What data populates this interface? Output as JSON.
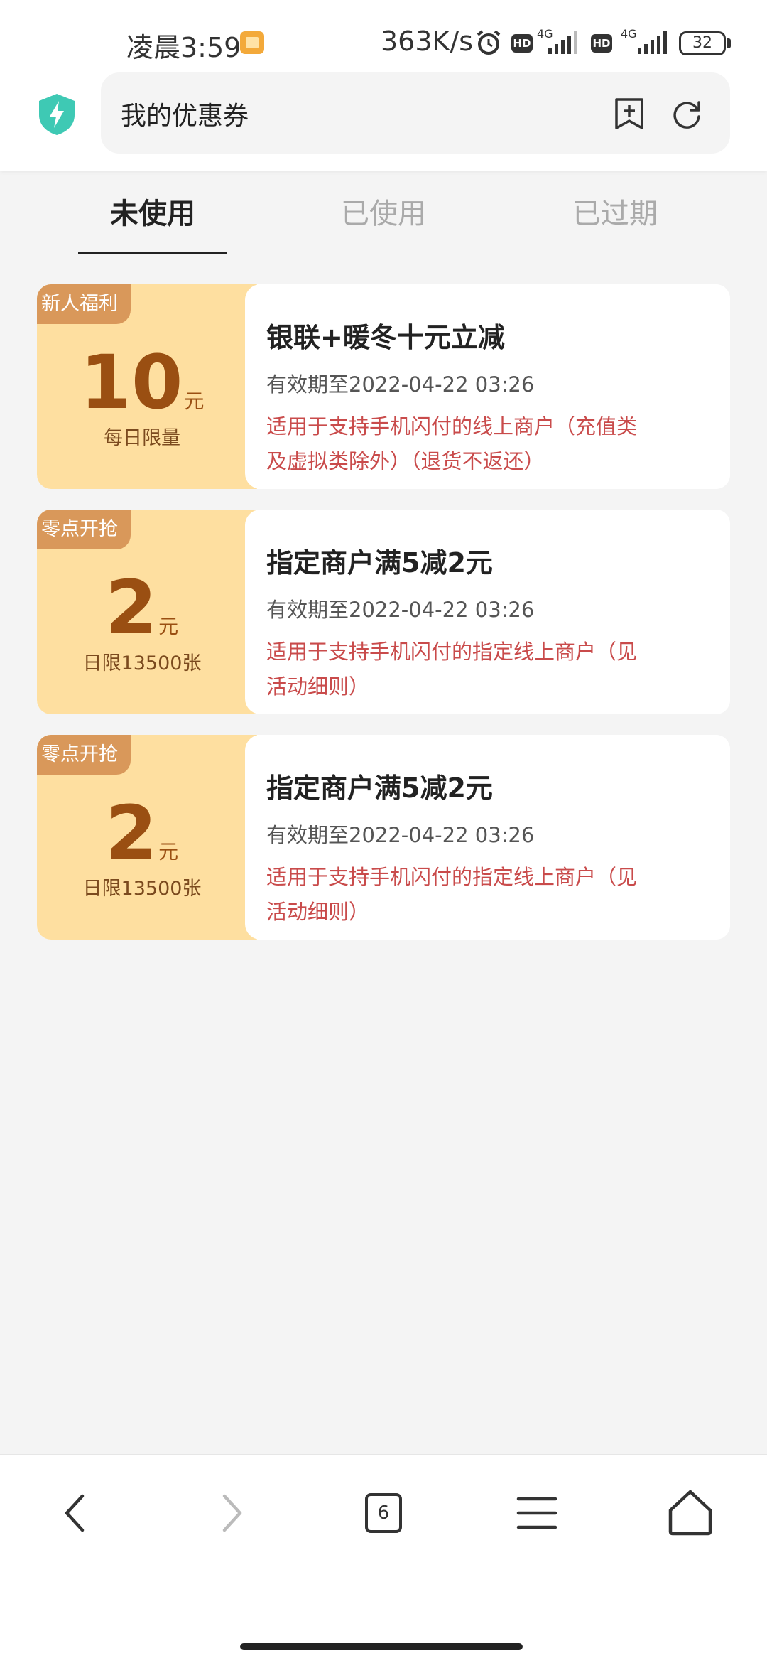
{
  "status_bar": {
    "time": "凌晨3:59",
    "speed": "363K/s",
    "hd": "HD",
    "network": "4G",
    "battery": "32"
  },
  "address_bar": {
    "title": "我的优惠券"
  },
  "tabs": [
    {
      "label": "未使用",
      "active": true
    },
    {
      "label": "已使用",
      "active": false
    },
    {
      "label": "已过期",
      "active": false
    }
  ],
  "coupons": [
    {
      "tag": "新人福利",
      "amount": "10",
      "unit": "元",
      "limit": "每日限量",
      "title": "银联+暖冬十元立减",
      "validity": "有效期至2022-04-22 03:26",
      "description": "适用于支持手机闪付的线上商户（充值类及虚拟类除外）（退货不返还）"
    },
    {
      "tag": "零点开抢",
      "amount": "2",
      "unit": "元",
      "limit": "日限13500张",
      "title": "指定商户满5减2元",
      "validity": "有效期至2022-04-22 03:26",
      "description": "适用于支持手机闪付的指定线上商户（见活动细则）"
    },
    {
      "tag": "零点开抢",
      "amount": "2",
      "unit": "元",
      "limit": "日限13500张",
      "title": "指定商户满5减2元",
      "validity": "有效期至2022-04-22 03:26",
      "description": "适用于支持手机闪付的指定线上商户（见活动细则）"
    }
  ],
  "bottom_nav": {
    "tabs_count": "6",
    "icons": [
      "back-icon",
      "forward-icon",
      "tabs-icon",
      "menu-icon",
      "home-icon"
    ]
  },
  "colors": {
    "coupon_left_bg": "#fedfa0",
    "coupon_tag_bg": "#d9985a",
    "amount_color": "#9a4f12",
    "description_color": "#c94b4b",
    "shield_color": "#3ec9b4"
  }
}
